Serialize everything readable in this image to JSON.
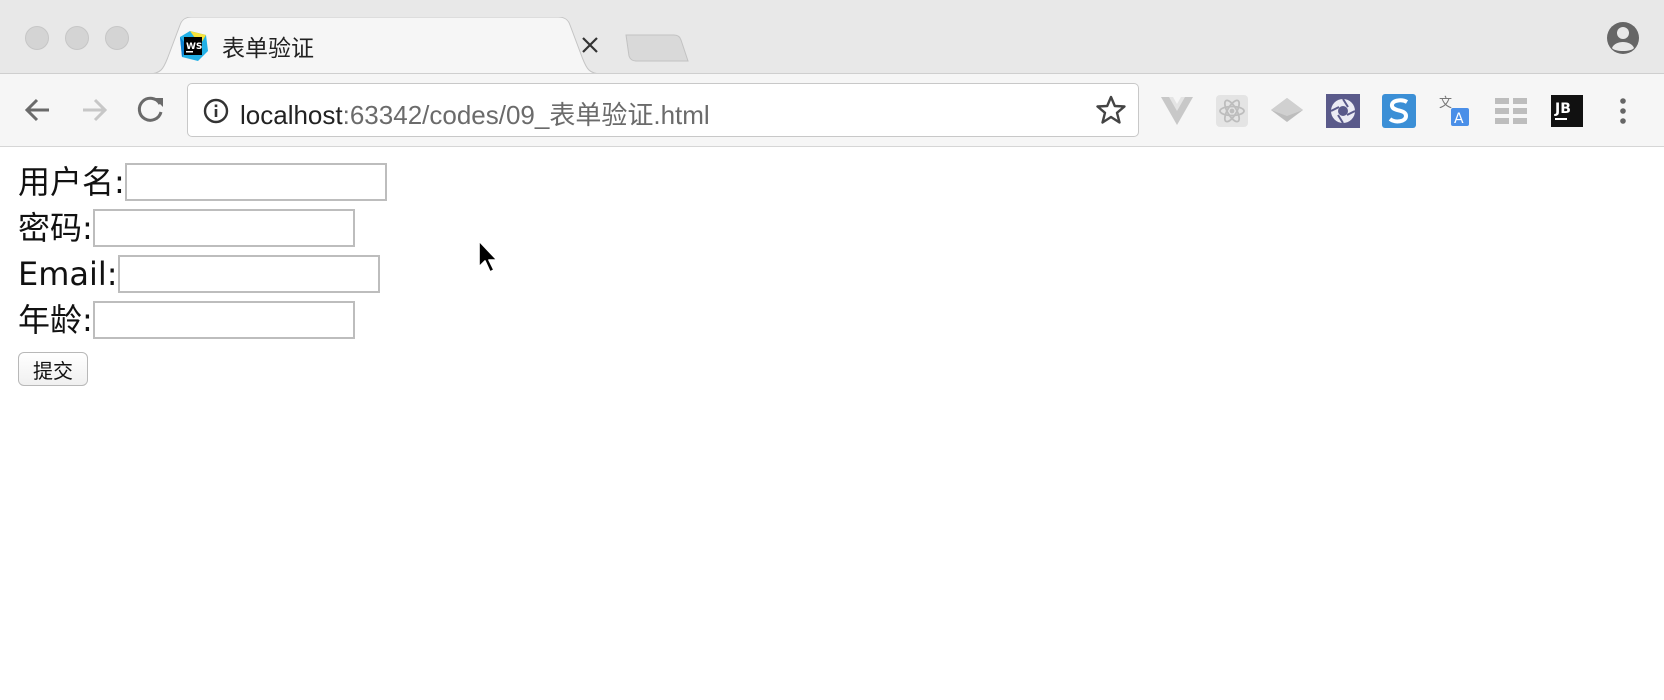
{
  "browser": {
    "tab": {
      "title": "表单验证",
      "favicon": "webstorm-icon"
    },
    "address": {
      "host": "localhost",
      "rest": ":63342/codes/09_表单验证.html"
    },
    "extensions": [
      "vue-devtools-icon",
      "react-devtools-icon",
      "layers-icon",
      "aperture-icon",
      "s-extension-icon",
      "translate-icon",
      "grid-extension-icon",
      "jetbrains-icon",
      "menu-dots-icon"
    ],
    "jb_label": "JB",
    "ws_label": "WS"
  },
  "form": {
    "username_label": "用户名:",
    "password_label": "密码:",
    "email_label": "Email:",
    "age_label": "年龄:",
    "submit_label": "提交",
    "username_value": "",
    "password_value": "",
    "email_value": "",
    "age_value": ""
  }
}
